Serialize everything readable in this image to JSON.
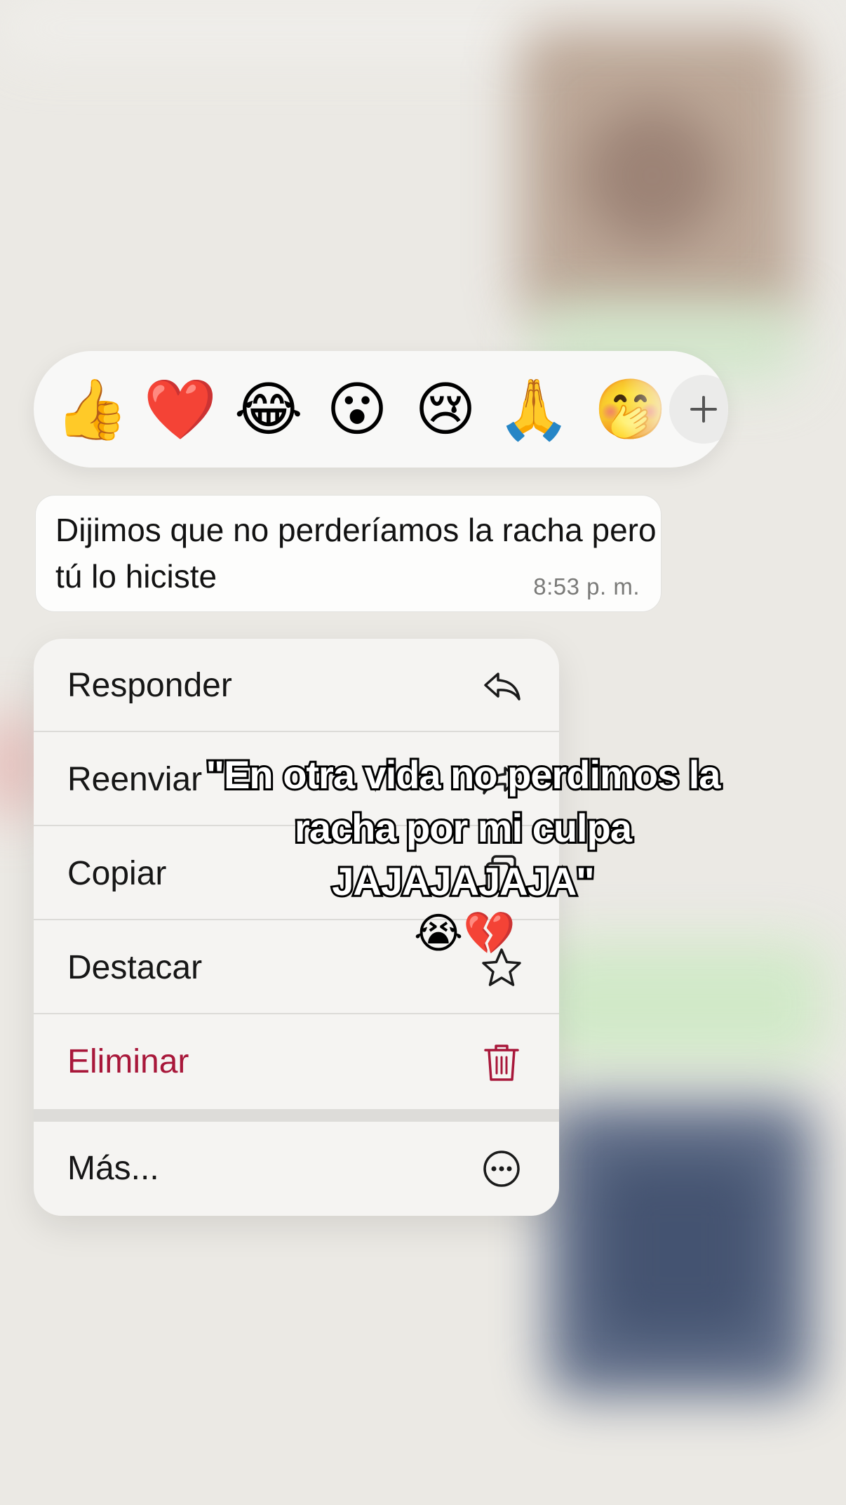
{
  "reactions": {
    "items": [
      {
        "name": "thumbs-up",
        "glyph": "👍"
      },
      {
        "name": "red-heart",
        "glyph": "❤️"
      },
      {
        "name": "tears-of-joy",
        "glyph": "😂"
      },
      {
        "name": "surprised-face",
        "glyph": "😮"
      },
      {
        "name": "crying-face",
        "glyph": "😢"
      },
      {
        "name": "folded-hands",
        "glyph": "🙏"
      },
      {
        "name": "partial-face",
        "glyph": "🤭"
      }
    ],
    "add_icon": "plus-icon"
  },
  "message": {
    "text": "Dijimos que no perderíamos la racha pero tú lo hiciste",
    "time": "8:53 p. m."
  },
  "menu": {
    "items": [
      {
        "label": "Responder",
        "icon": "reply-icon"
      },
      {
        "label": "Reenviar",
        "icon": "forward-icon"
      },
      {
        "label": "Copiar",
        "icon": "copy-icon"
      },
      {
        "label": "Destacar",
        "icon": "star-icon"
      },
      {
        "label": "Eliminar",
        "icon": "trash-icon",
        "color": "#a8173a"
      },
      {
        "label": "Más...",
        "icon": "more-icon"
      }
    ]
  },
  "caption": {
    "text": "\"En otra vida no perdimos la racha por mi culpa JAJAJAJAJA\"",
    "emoji": "😭💔"
  }
}
